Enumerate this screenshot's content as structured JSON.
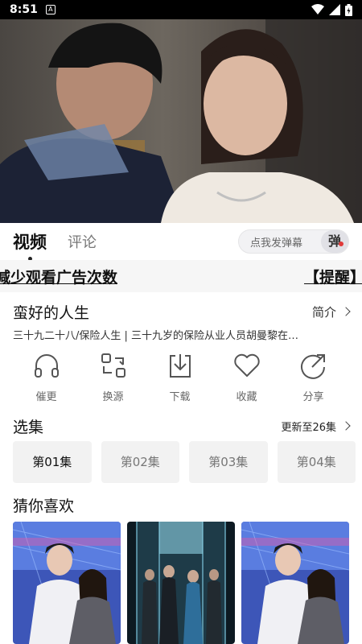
{
  "status_bar": {
    "time": "8:51",
    "notification_icon": "A"
  },
  "tabs": [
    {
      "label": "视频"
    },
    {
      "label": "评论"
    }
  ],
  "danmu": {
    "placeholder": "点我发弹幕",
    "button": "弹"
  },
  "notice": {
    "message": "减少观看广告次数",
    "remind": "【提醒】"
  },
  "show": {
    "title": "蛮好的人生",
    "intro_label": "简介",
    "description": "三十九二十八/保险人生 | 三十九岁的保险从业人员胡曼黎在…"
  },
  "actions": [
    {
      "label": "催更",
      "icon": "headphones-icon"
    },
    {
      "label": "换源",
      "icon": "switch-source-icon"
    },
    {
      "label": "下载",
      "icon": "download-icon"
    },
    {
      "label": "收藏",
      "icon": "heart-icon"
    },
    {
      "label": "分享",
      "icon": "share-icon"
    }
  ],
  "episodes": {
    "heading": "选集",
    "update_text": "更新至26集",
    "items": [
      "第01集",
      "第02集",
      "第03集",
      "第04集"
    ]
  },
  "recommend": {
    "heading": "猜你喜欢"
  }
}
